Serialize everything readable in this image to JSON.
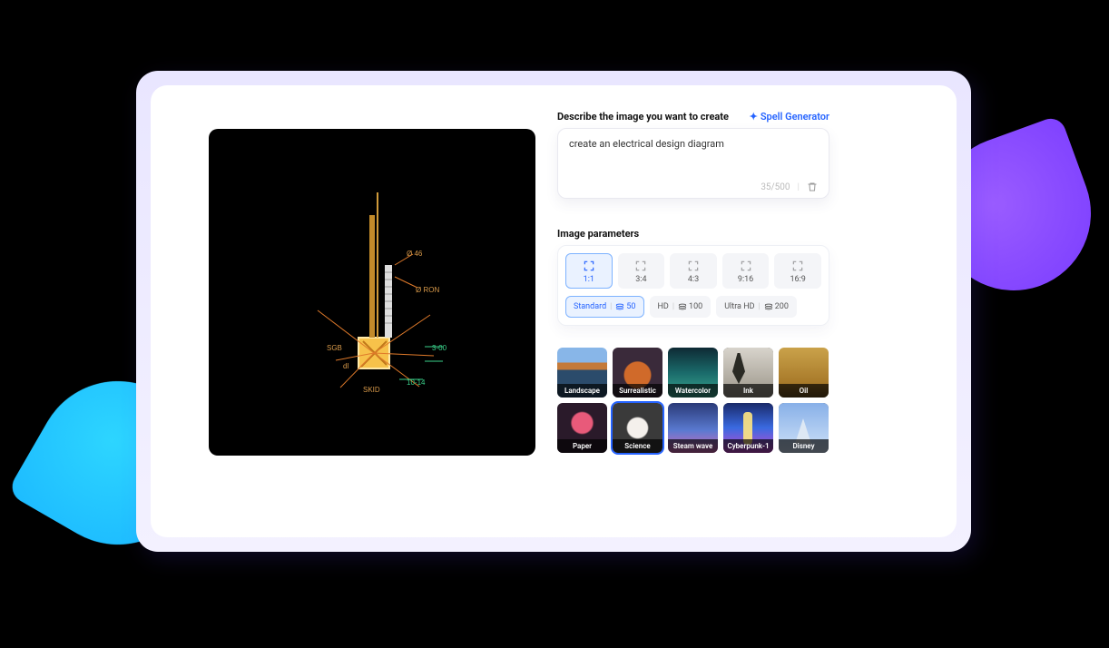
{
  "describe": {
    "label": "Describe the image you want to create",
    "spell_generator": "Spell Generator",
    "prompt_value": "create an electrical design diagram",
    "char_count": "35/500"
  },
  "params": {
    "title": "Image parameters",
    "ratios": [
      {
        "label": "1:1",
        "active": true
      },
      {
        "label": "3:4",
        "active": false
      },
      {
        "label": "4:3",
        "active": false
      },
      {
        "label": "9:16",
        "active": false
      },
      {
        "label": "16:9",
        "active": false
      }
    ],
    "resolutions": [
      {
        "name": "Standard",
        "cost": "50",
        "active": true
      },
      {
        "name": "HD",
        "cost": "100",
        "active": false
      },
      {
        "name": "Ultra HD",
        "cost": "200",
        "active": false
      }
    ]
  },
  "styles": [
    {
      "label": "Landscape",
      "cls": "th-landscape",
      "active": false
    },
    {
      "label": "Surrealistic",
      "cls": "th-surrealistic",
      "active": false
    },
    {
      "label": "Watercolor",
      "cls": "th-watercolor",
      "active": false
    },
    {
      "label": "Ink",
      "cls": "th-ink",
      "active": false
    },
    {
      "label": "Oil",
      "cls": "th-oil",
      "active": false
    },
    {
      "label": "Paper",
      "cls": "th-paper",
      "active": false
    },
    {
      "label": "Science",
      "cls": "th-science",
      "active": true
    },
    {
      "label": "Steam wave",
      "cls": "th-steam",
      "active": false
    },
    {
      "label": "Cyberpunk-1",
      "cls": "th-cyberpunk",
      "active": false
    },
    {
      "label": "Disney",
      "cls": "th-disney",
      "active": false
    }
  ],
  "preview": {
    "annotations": [
      "Ø 46",
      "Ø RON",
      "SGB",
      "3-00",
      "10-14",
      "SKID",
      "dl"
    ]
  }
}
